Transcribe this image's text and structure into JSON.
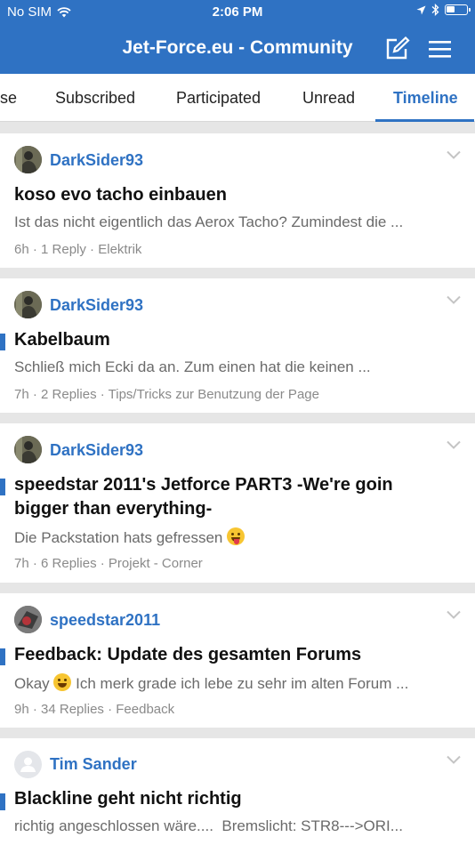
{
  "status_bar": {
    "carrier": "No SIM",
    "time": "2:06 PM"
  },
  "header": {
    "title": "Jet-Force.eu - Community"
  },
  "tabs": [
    {
      "label": "se"
    },
    {
      "label": "Subscribed"
    },
    {
      "label": "Participated"
    },
    {
      "label": "Unread"
    },
    {
      "label": "Timeline"
    }
  ],
  "active_tab": "Timeline",
  "threads": [
    {
      "author": "DarkSider93",
      "title": "koso evo tacho einbauen",
      "excerpt": "Ist das nicht eigentlich das Aerox Tacho? Zumindest die ...",
      "time": "6h",
      "replies": "1 Reply",
      "forum": "Elektrik",
      "unread": false
    },
    {
      "author": "DarkSider93",
      "title": "Kabelbaum",
      "excerpt": "Schließ mich Ecki da an. Zum einen hat die keinen ...",
      "time": "7h",
      "replies": "2 Replies",
      "forum": "Tips/Tricks zur Benutzung der Page",
      "unread": true
    },
    {
      "author": "DarkSider93",
      "title": "speedstar 2011's Jetforce PART3 -We're goin bigger than everything-",
      "excerpt": "Die Packstation hats gefressen",
      "time": "7h",
      "replies": "6 Replies",
      "forum": "Projekt - Corner",
      "unread": true
    },
    {
      "author": "speedstar2011",
      "title": "Feedback: Update des gesamten Forums",
      "excerpt_pre": "Okay",
      "excerpt": "Ich merk grade ich lebe zu sehr im alten Forum ...",
      "time": "9h",
      "replies": "34 Replies",
      "forum": "Feedback",
      "unread": true
    },
    {
      "author": "Tim Sander",
      "title": "Blackline geht nicht richtig",
      "excerpt": "richtig angeschlossen wäre....  Bremslicht: STR8--->ORI...",
      "unread": true
    }
  ],
  "colors": {
    "accent": "#2f72c3",
    "background": "#e6e6e6"
  }
}
